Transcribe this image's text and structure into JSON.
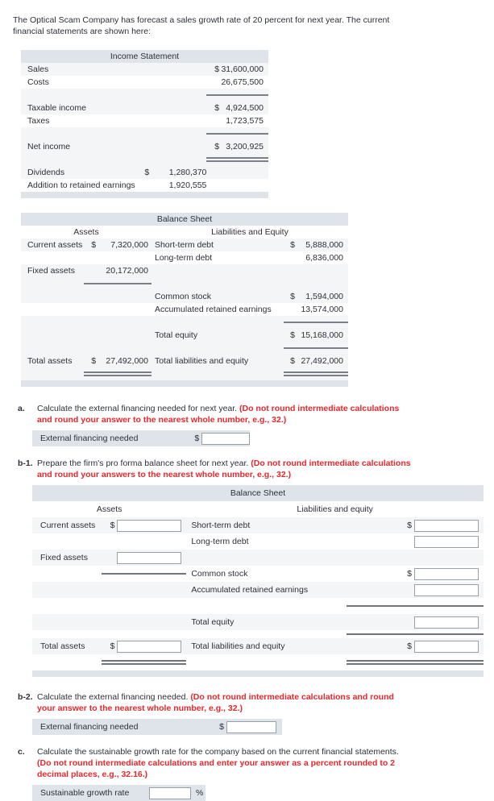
{
  "intro": "The Optical Scam Company has forecast a sales growth rate of 20 percent for next year. The current financial statements are shown here:",
  "income_statement": {
    "title": "Income Statement",
    "rows": [
      {
        "label": "Sales",
        "currency": "$",
        "value": "31,600,000"
      },
      {
        "label": "Costs",
        "currency": "",
        "value": "26,675,500"
      },
      {
        "label": "Taxable income",
        "currency": "$",
        "value": "4,924,500"
      },
      {
        "label": "Taxes",
        "currency": "",
        "value": "1,723,575"
      },
      {
        "label": "Net income",
        "currency": "$",
        "value": "3,200,925"
      },
      {
        "label": "Dividends",
        "currency": "$",
        "value": "1,280,370"
      },
      {
        "label": "Addition to retained earnings",
        "currency": "",
        "value": "1,920,555"
      }
    ]
  },
  "balance_sheet": {
    "title": "Balance Sheet",
    "assets_header": "Assets",
    "liabilities_header": "Liabilities and Equity",
    "assets": [
      {
        "label": "Current assets",
        "currency": "$",
        "value": "7,320,000"
      },
      {
        "label": "Fixed assets",
        "currency": "",
        "value": "20,172,000"
      },
      {
        "label": "Total assets",
        "currency": "$",
        "value": "27,492,000"
      }
    ],
    "liabilities": [
      {
        "label": "Short-term debt",
        "currency": "$",
        "value": "5,888,000"
      },
      {
        "label": "Long-term debt",
        "currency": "",
        "value": "6,836,000"
      },
      {
        "label": "Common stock",
        "currency": "$",
        "value": "1,594,000"
      },
      {
        "label": "Accumulated retained earnings",
        "currency": "",
        "value": "13,574,000"
      },
      {
        "label": "Total equity",
        "currency": "$",
        "value": "15,168,000"
      },
      {
        "label": "Total liabilities and equity",
        "currency": "$",
        "value": "27,492,000"
      }
    ]
  },
  "question_a": {
    "tag": "a.",
    "text_black": "Calculate the external financing needed for next year.",
    "text_red": "(Do not round intermediate calculations and round your answer to the nearest whole number, e.g., 32.)",
    "answer_label": "External financing needed",
    "currency": "$",
    "answer_value": ""
  },
  "question_b1": {
    "tag": "b-1.",
    "text_black": "Prepare the firm's pro forma balance sheet for next year.",
    "text_red": "(Do not round intermediate calculations and round your answers to the nearest whole number, e.g., 32.)",
    "table": {
      "title": "Balance Sheet",
      "assets_header": "Assets",
      "liabilities_header": "Liabilities and equity",
      "assets": [
        {
          "label": "Current assets",
          "currency": "$",
          "value": ""
        },
        {
          "label": "Fixed assets",
          "currency": "",
          "value": ""
        },
        {
          "label": "Total assets",
          "currency": "$",
          "value": ""
        }
      ],
      "liabilities": [
        {
          "label": "Short-term debt",
          "currency": "$",
          "value": ""
        },
        {
          "label": "Long-term debt",
          "currency": "",
          "value": ""
        },
        {
          "label": "Common stock",
          "currency": "$",
          "value": ""
        },
        {
          "label": "Accumulated retained earnings",
          "currency": "",
          "value": ""
        },
        {
          "label": "Total equity",
          "currency": "",
          "value": ""
        },
        {
          "label": "Total liabilities and equity",
          "currency": "$",
          "value": ""
        }
      ]
    }
  },
  "question_b2": {
    "tag": "b-2.",
    "text_black": "Calculate the external financing needed.",
    "text_red": "(Do not round intermediate calculations and round your answer to the nearest whole number, e.g., 32.)",
    "answer_label": "External financing needed",
    "currency": "$",
    "answer_value": ""
  },
  "question_c": {
    "tag": "c.",
    "text_black": "Calculate the sustainable growth rate for the company based on the current financial statements.",
    "text_red": "(Do not round intermediate calculations and enter your answer as a percent rounded to 2 decimal places, e.g., 32.16.)",
    "answer_label": "Sustainable growth rate",
    "percent_symbol": "%",
    "answer_value": ""
  }
}
